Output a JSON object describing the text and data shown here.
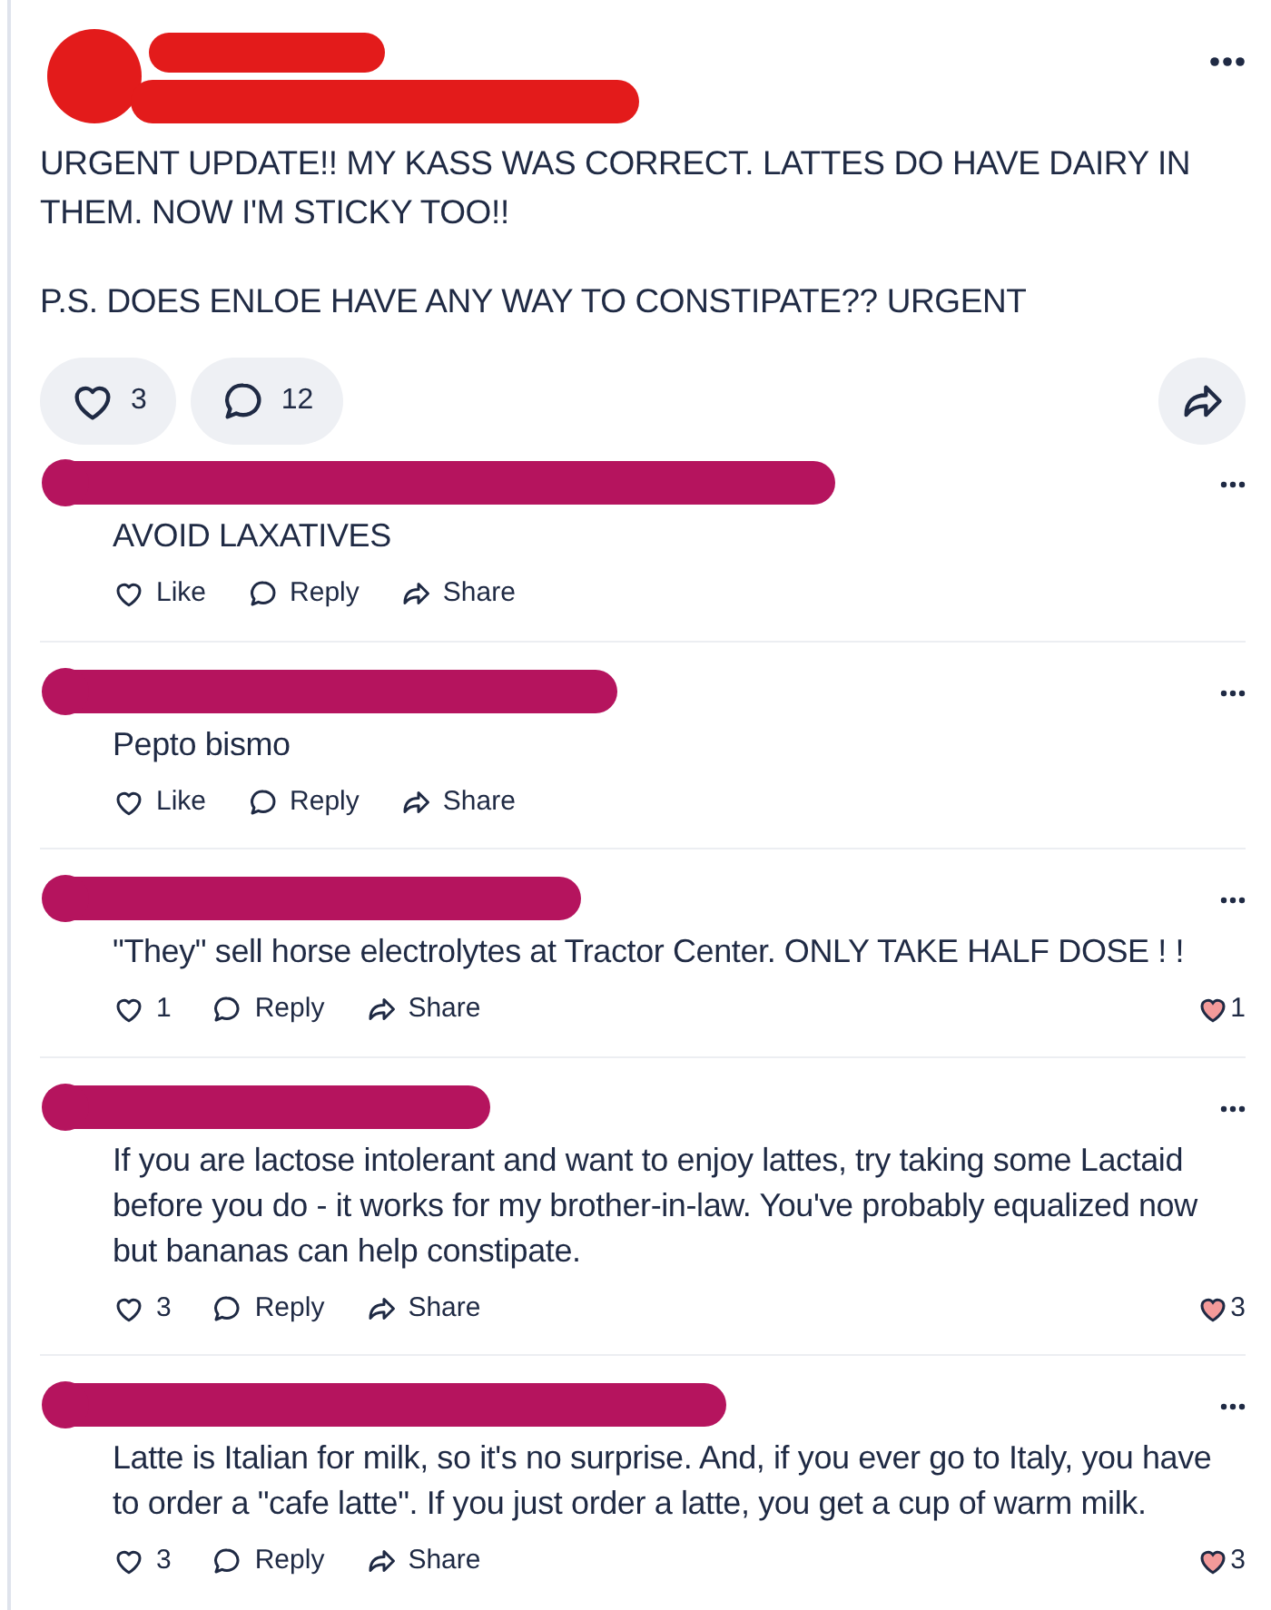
{
  "post": {
    "text": [
      "URGENT UPDATE!! MY KASS WAS CORRECT. LATTES DO HAVE DAIRY IN THEM. NOW I'M STICKY TOO!!",
      "P.S. DOES ENLOE HAVE ANY WAY TO CONSTIPATE?? URGENT"
    ],
    "likes": "3",
    "comments": "12"
  },
  "comments": [
    {
      "text": "AVOID LAXATIVES",
      "like": "Like",
      "reply": "Reply",
      "share": "Share"
    },
    {
      "text": "Pepto bismo",
      "like": "Like",
      "reply": "Reply",
      "share": "Share"
    },
    {
      "text": "\"They\" sell horse electrolytes at Tractor Center. ONLY TAKE HALF DOSE ! !",
      "like": "1",
      "reply": "Reply",
      "share": "Share",
      "reactions": "1"
    },
    {
      "text": "If you are lactose intolerant and want to enjoy lattes, try taking some Lactaid before you do - it works for my brother-in-law.  You've probably equalized now but bananas can help constipate.",
      "like": "3",
      "reply": "Reply",
      "share": "Share",
      "reactions": "3"
    },
    {
      "text": "Latte is Italian for milk, so it's no surprise.  And, if you ever go to Italy, you have to order a \"cafe latte\".  If you just order a latte, you get a cup of warm milk.",
      "like": "3",
      "reply": "Reply",
      "share": "Share",
      "reactions": "3"
    }
  ]
}
